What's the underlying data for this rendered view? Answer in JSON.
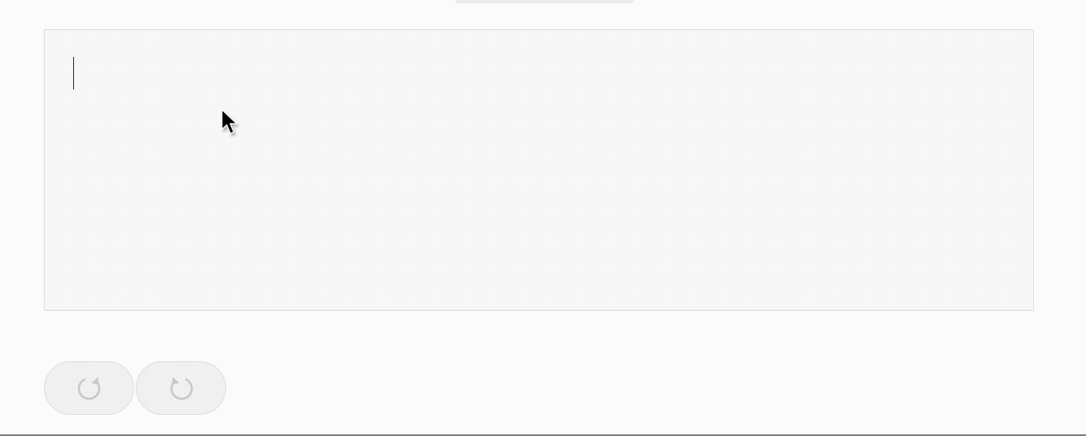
{
  "editor": {
    "value": "",
    "caret_visible": true
  },
  "toolbar": {
    "undo_icon": "undo-icon",
    "redo_icon": "redo-icon"
  },
  "colors": {
    "background": "#fbfbfb",
    "editor_border": "#dcdcdc",
    "button_fill": "#f1f1f1",
    "icon_stroke": "#c8c8c8"
  }
}
